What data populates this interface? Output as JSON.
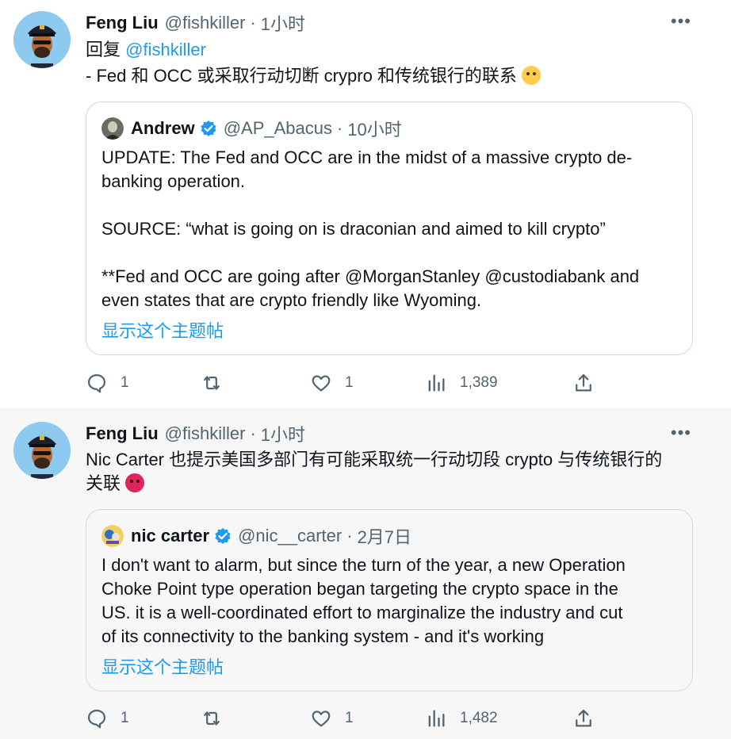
{
  "tweets": [
    {
      "author_name": "Feng Liu",
      "handle": "@fishkiller",
      "separator": "·",
      "time": "1小时",
      "reply_prefix": "回复",
      "reply_to": "@fishkiller",
      "text_lines": [
        "- Fed 和 OCC 或采取行动切断 crypro 和传统银行的联系"
      ],
      "emoji": "weary-face",
      "quote": {
        "author_name": "Andrew",
        "handle": "@AP_Abacus",
        "separator": "·",
        "time": "10小时",
        "text_lines": [
          "UPDATE: The Fed and OCC are in the midst of a massive crypto de-",
          "banking operation.",
          "SOURCE: “what is going on is draconian and aimed to kill crypto”",
          "**Fed and OCC are going after @MorganStanley @custodiabank and",
          "even states that are crypto friendly like Wyoming."
        ],
        "show_thread": "显示这个主题帖"
      },
      "actions": {
        "replies": "1",
        "retweets": "",
        "likes": "1",
        "views": "1,389"
      }
    },
    {
      "author_name": "Feng Liu",
      "handle": "@fishkiller",
      "separator": "·",
      "time": "1小时",
      "text_lines": [
        "Nic Carter 也提示美国多部门有可能采取统一行动切段 crypto 与传统银行的",
        "关联"
      ],
      "emoji": "angry-face",
      "quote": {
        "author_name": "nic carter",
        "handle": "@nic__carter",
        "separator": "·",
        "time": "2月7日",
        "text_lines": [
          "I don't want to alarm, but since the turn of the year, a new Operation",
          "Choke Point type operation began targeting the crypto space in the",
          "US. it is a well-coordinated effort to marginalize the industry and cut",
          "of its connectivity to the banking system - and it's working"
        ],
        "show_thread": "显示这个主题帖"
      },
      "actions": {
        "replies": "1",
        "retweets": "",
        "likes": "1",
        "views": "1,482"
      }
    }
  ],
  "more_label": "•••",
  "colors": {
    "link": "#1d9bf0",
    "secondary": "#536471",
    "border": "#cfd9de",
    "verified": "#1d9bf0"
  }
}
